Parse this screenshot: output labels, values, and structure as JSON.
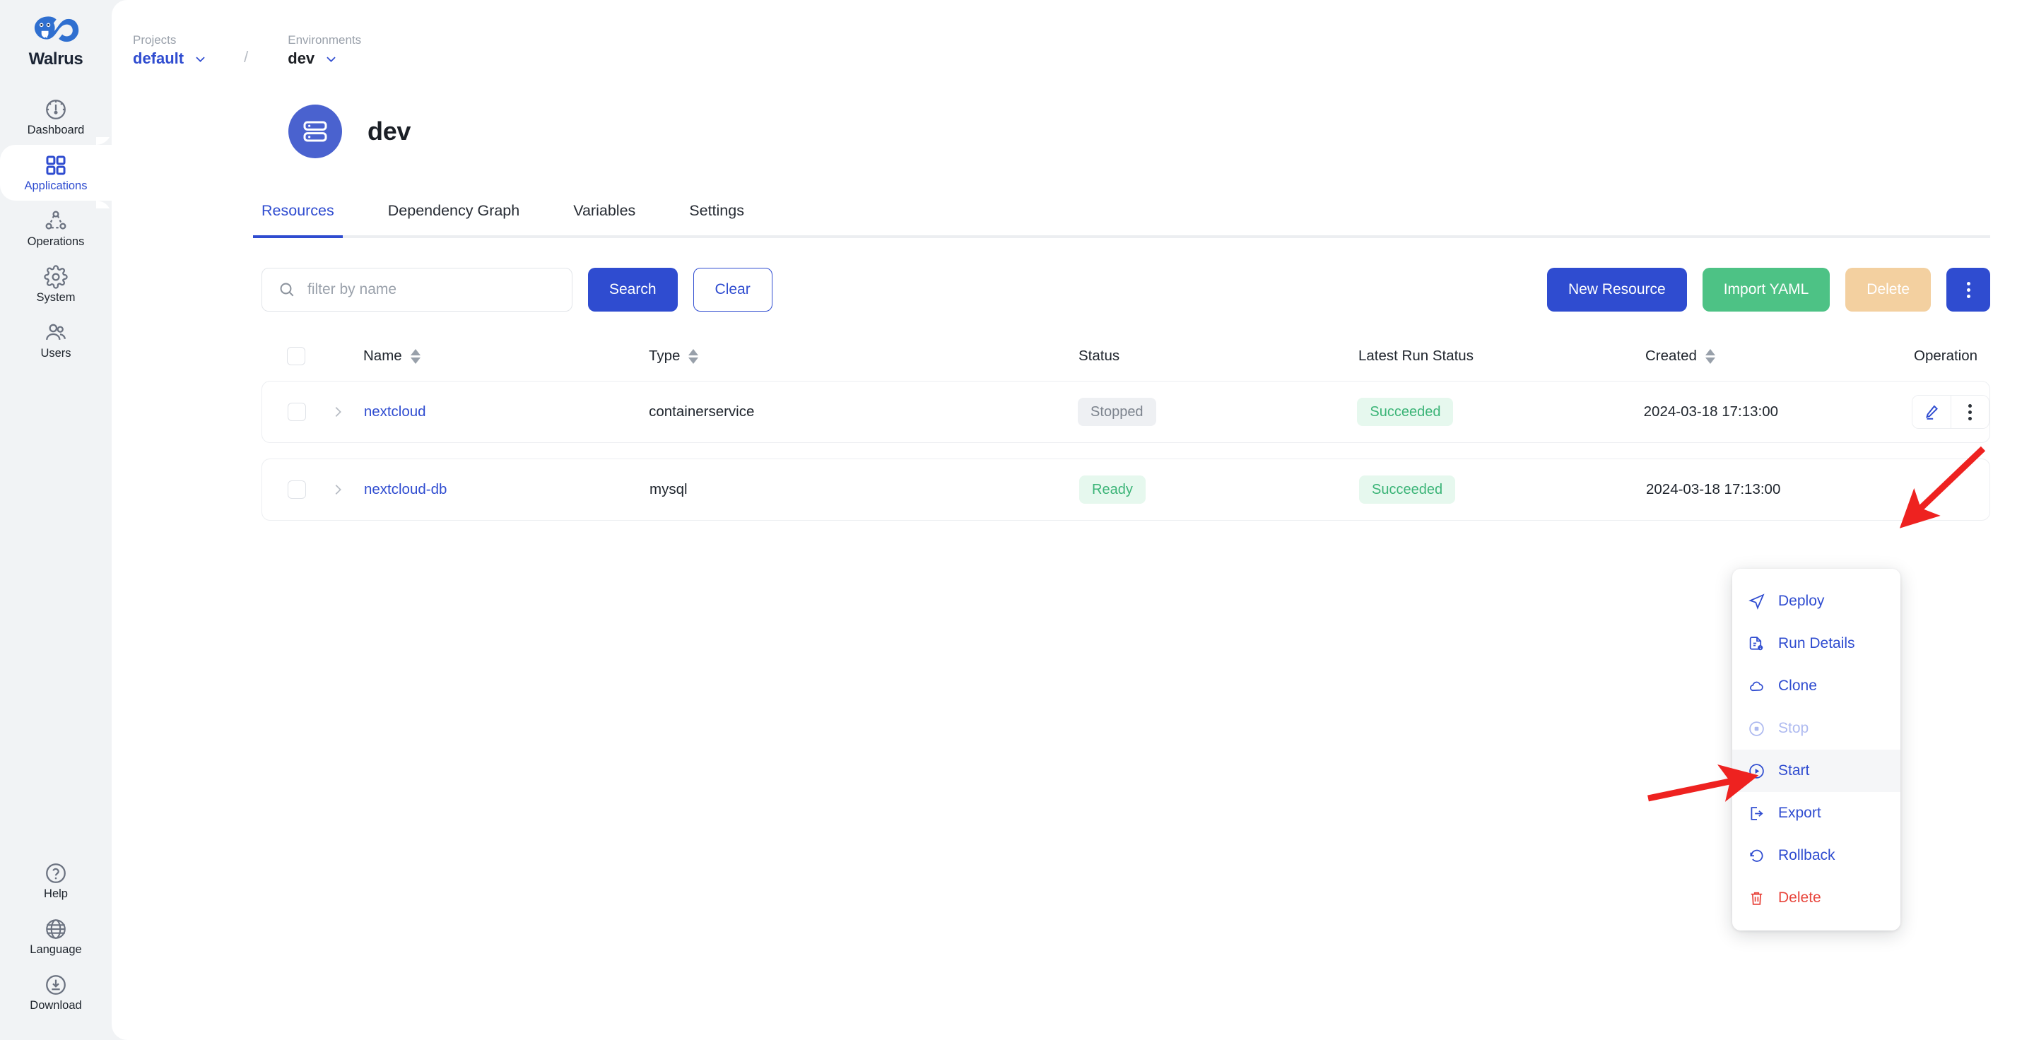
{
  "brand": {
    "name": "Walrus"
  },
  "sidebar": {
    "top_items": [
      {
        "label": "Dashboard",
        "icon": "gauge-icon",
        "active": false
      },
      {
        "label": "Applications",
        "icon": "grid-icon",
        "active": true
      },
      {
        "label": "Operations",
        "icon": "network-icon",
        "active": false
      },
      {
        "label": "System",
        "icon": "gear-icon",
        "active": false
      },
      {
        "label": "Users",
        "icon": "users-icon",
        "active": false
      }
    ],
    "bottom_items": [
      {
        "label": "Help",
        "icon": "question-circle-icon"
      },
      {
        "label": "Language",
        "icon": "globe-icon"
      },
      {
        "label": "Download",
        "icon": "download-circle-icon"
      }
    ]
  },
  "breadcrumb": {
    "project_label": "Projects",
    "project_value": "default",
    "separator": "/",
    "environment_label": "Environments",
    "environment_value": "dev"
  },
  "header": {
    "title": "dev",
    "avatar_icon": "server-icon"
  },
  "tabs": [
    {
      "label": "Resources",
      "active": true
    },
    {
      "label": "Dependency Graph",
      "active": false
    },
    {
      "label": "Variables",
      "active": false
    },
    {
      "label": "Settings",
      "active": false
    }
  ],
  "toolbar": {
    "search_placeholder": "filter by name",
    "search_value": "",
    "search_button": "Search",
    "clear_button": "Clear",
    "new_resource_button": "New Resource",
    "import_yaml_button": "Import YAML",
    "delete_button": "Delete",
    "more_button_icon": "vertical-dots-icon"
  },
  "table": {
    "columns": [
      {
        "label": "Name",
        "sortable": true
      },
      {
        "label": "Type",
        "sortable": true
      },
      {
        "label": "Status",
        "sortable": false
      },
      {
        "label": "Latest Run Status",
        "sortable": false
      },
      {
        "label": "Created",
        "sortable": true
      },
      {
        "label": "Operation",
        "sortable": false
      }
    ],
    "rows": [
      {
        "name": "nextcloud",
        "type": "containerservice",
        "status": "Stopped",
        "status_style": "gray",
        "latest_run_status": "Succeeded",
        "created": "2024-03-18 17:13:00"
      },
      {
        "name": "nextcloud-db",
        "type": "mysql",
        "status": "Ready",
        "status_style": "green",
        "latest_run_status": "Succeeded",
        "created": "2024-03-18 17:13:00"
      }
    ]
  },
  "operation_menu": {
    "items": [
      {
        "label": "Deploy",
        "icon": "send-icon",
        "state": "normal"
      },
      {
        "label": "Run Details",
        "icon": "file-info-icon",
        "state": "normal"
      },
      {
        "label": "Clone",
        "icon": "cloud-icon",
        "state": "normal"
      },
      {
        "label": "Stop",
        "icon": "stop-circle-icon",
        "state": "disabled"
      },
      {
        "label": "Start",
        "icon": "play-circle-icon",
        "state": "highlight"
      },
      {
        "label": "Export",
        "icon": "export-icon",
        "state": "normal"
      },
      {
        "label": "Rollback",
        "icon": "rollback-icon",
        "state": "normal"
      },
      {
        "label": "Delete",
        "icon": "trash-icon",
        "state": "danger"
      }
    ]
  },
  "colors": {
    "accent": "#2f4cd0",
    "green": "#4dc285",
    "amber": "#f3d0a0",
    "danger": "#e8453c",
    "annotation_arrow": "#ee2220",
    "sidebar_bg": "#f1f3f5"
  }
}
